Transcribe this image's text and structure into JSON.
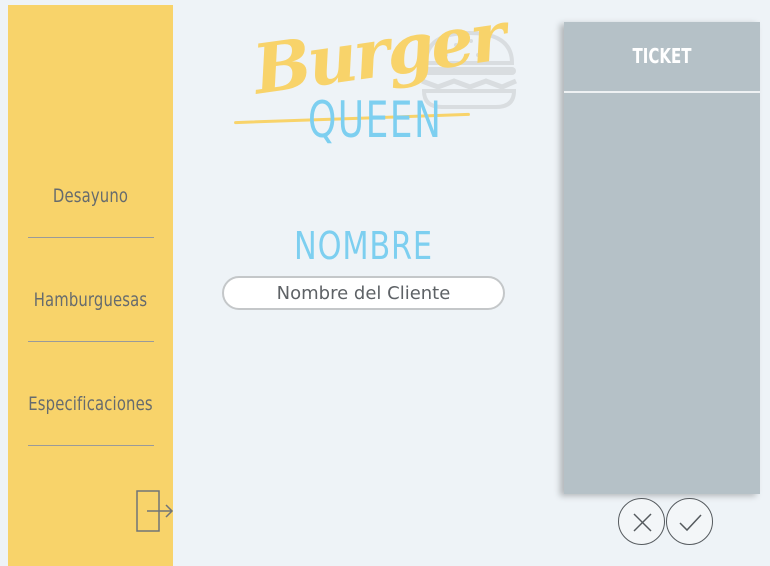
{
  "logo": {
    "script_text": "Burger",
    "sub_text": "QUEEN",
    "icon": "burger-icon"
  },
  "sidebar": {
    "items": [
      {
        "label": "Desayuno"
      },
      {
        "label": "Hamburguesas"
      },
      {
        "label": "Especificaciones"
      }
    ],
    "exit_icon": "logout-icon"
  },
  "main": {
    "name_title": "NOMBRE",
    "name_input": {
      "placeholder": "Nombre del Cliente",
      "value": ""
    }
  },
  "ticket": {
    "title": "TICKET",
    "cancel_icon": "close-icon",
    "confirm_icon": "check-icon"
  },
  "colors": {
    "background": "#eef3f7",
    "sidebar": "#f8d36a",
    "accent_blue": "#7dcff0",
    "ticket_panel": "#b5c1c7"
  }
}
